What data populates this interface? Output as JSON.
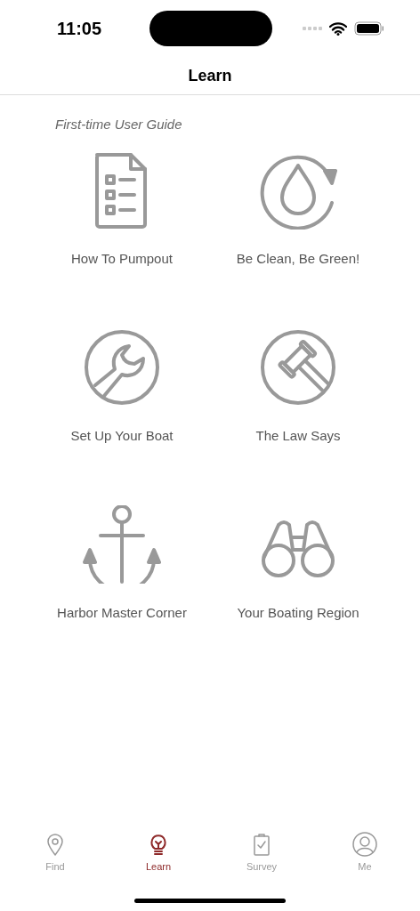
{
  "status_bar": {
    "time": "11:05"
  },
  "nav": {
    "title": "Learn"
  },
  "section_label": "First-time User Guide",
  "guides": [
    {
      "label": "How To Pumpout",
      "kind": "checklist"
    },
    {
      "label": "Be Clean, Be Green!",
      "kind": "drop"
    },
    {
      "label": "Set Up Your Boat",
      "kind": "wrench"
    },
    {
      "label": "The Law Says",
      "kind": "gavel"
    },
    {
      "label": "Harbor Master Corner",
      "kind": "anchor"
    },
    {
      "label": "Your Boating Region",
      "kind": "binoculars"
    }
  ],
  "tabs": [
    {
      "label": "Find",
      "kind": "pin",
      "selected": false
    },
    {
      "label": "Learn",
      "kind": "bulb",
      "selected": true
    },
    {
      "label": "Survey",
      "kind": "clipboard",
      "selected": false
    },
    {
      "label": "Me",
      "kind": "person",
      "selected": false
    }
  ]
}
